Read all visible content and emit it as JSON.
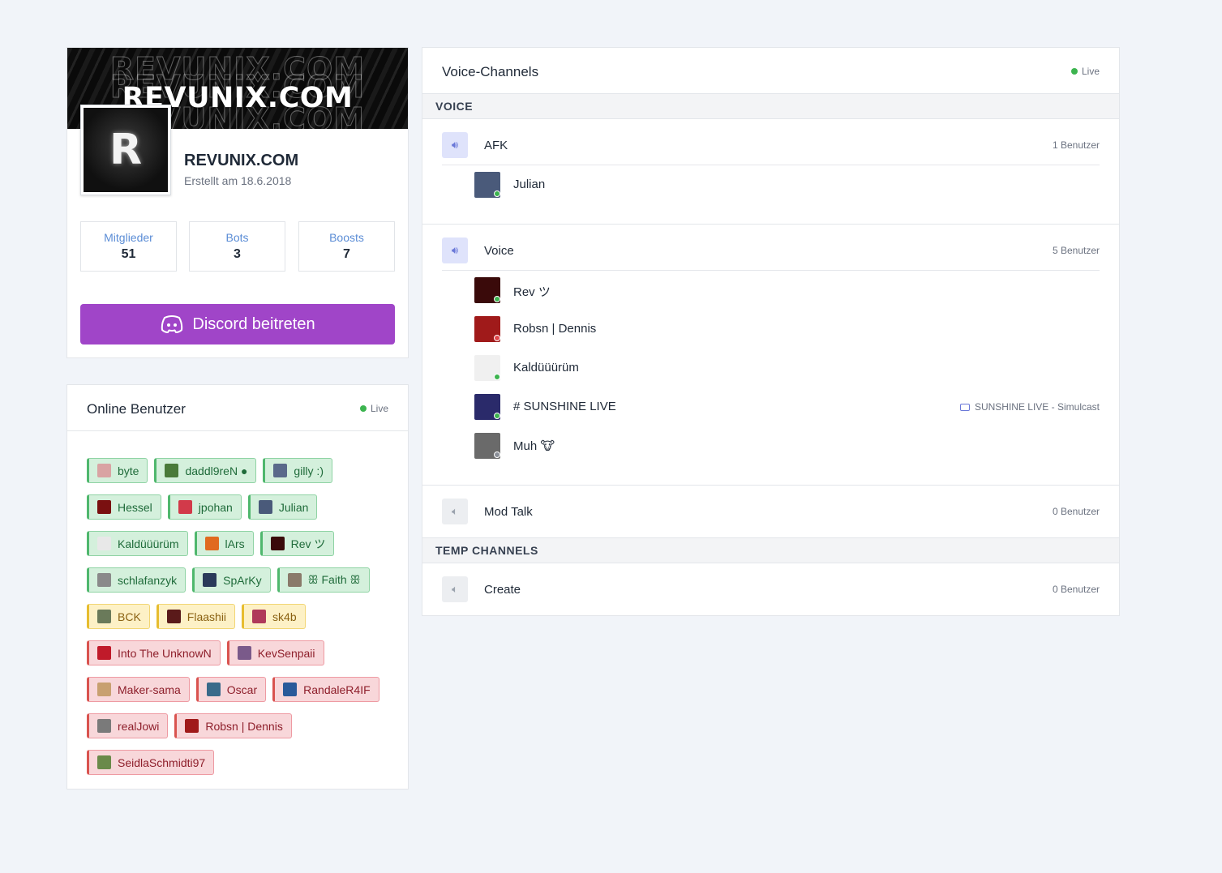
{
  "server": {
    "banner_text": "REVUNIX.COM",
    "icon_letter": "R",
    "name": "REVUNIX.COM",
    "created": "Erstellt am 18.6.2018",
    "stats": {
      "members_label": "Mitglieder",
      "members_value": "51",
      "bots_label": "Bots",
      "bots_value": "3",
      "boosts_label": "Boosts",
      "boosts_value": "7"
    },
    "join_label": "Discord beitreten",
    "join_color": "#a045c8"
  },
  "online": {
    "title": "Online Benutzer",
    "live_label": "Live",
    "users": [
      {
        "name": "byte",
        "status": "online",
        "avatar": "#d9a3a3"
      },
      {
        "name": "daddl9reN ●",
        "status": "online",
        "avatar": "#4a7a3a"
      },
      {
        "name": "gilly :)",
        "status": "online",
        "avatar": "#5a6a8a"
      },
      {
        "name": "Hessel",
        "status": "online",
        "avatar": "#7a1010"
      },
      {
        "name": "jpohan",
        "status": "online",
        "avatar": "#d23a4a"
      },
      {
        "name": "Julian",
        "status": "online",
        "avatar": "#4a5a7a"
      },
      {
        "name": "Kaldüüürüm",
        "status": "online",
        "avatar": "#e8e8e8"
      },
      {
        "name": "lArs",
        "status": "online",
        "avatar": "#e06a20"
      },
      {
        "name": "Rev ツ",
        "status": "online",
        "avatar": "#3a0a0a"
      },
      {
        "name": "schlafanzyk",
        "status": "online",
        "avatar": "#8a8a8a"
      },
      {
        "name": "SpArKy",
        "status": "online",
        "avatar": "#2a3a5a"
      },
      {
        "name": "ꕥ Faith ꕥ",
        "status": "online",
        "avatar": "#8a7a6a"
      },
      {
        "name": "BCK",
        "status": "idle",
        "avatar": "#6a7a5a"
      },
      {
        "name": "Flaashii",
        "status": "idle",
        "avatar": "#5a1a1a"
      },
      {
        "name": "sk4b",
        "status": "idle",
        "avatar": "#b03a5a"
      },
      {
        "name": "Into The UnknowN",
        "status": "dnd",
        "avatar": "#c01a2a"
      },
      {
        "name": "KevSenpaii",
        "status": "dnd",
        "avatar": "#7a5a8a"
      },
      {
        "name": "Maker-sama",
        "status": "dnd",
        "avatar": "#c8a070"
      },
      {
        "name": "Oscar",
        "status": "dnd",
        "avatar": "#3a6a8a"
      },
      {
        "name": "RandaleR4IF",
        "status": "dnd",
        "avatar": "#2a5a9a"
      },
      {
        "name": "realJowi",
        "status": "dnd",
        "avatar": "#7a7a7a"
      },
      {
        "name": "Robsn | Dennis",
        "status": "dnd",
        "avatar": "#a01a1a"
      },
      {
        "name": "SeidlaSchmidti97",
        "status": "dnd",
        "avatar": "#6a8a4a"
      }
    ]
  },
  "voice": {
    "title": "Voice-Channels",
    "live_label": "Live",
    "sections": [
      {
        "name": "VOICE"
      },
      {
        "name": "TEMP CHANNELS"
      }
    ],
    "channels": {
      "afk": {
        "name": "AFK",
        "count": "1 Benutzer",
        "icon": "speaker-icon"
      },
      "voice": {
        "name": "Voice",
        "count": "5 Benutzer",
        "icon": "speaker-icon"
      },
      "modtalk": {
        "name": "Mod Talk",
        "count": "0 Benutzer",
        "icon": "speaker-muted-icon"
      },
      "create": {
        "name": "Create",
        "count": "0 Benutzer",
        "icon": "speaker-muted-icon"
      }
    },
    "afk_members": [
      {
        "name": "Julian",
        "status": "online",
        "avatar": "#4a5a7a"
      }
    ],
    "voice_members": [
      {
        "name": "Rev ツ",
        "status": "online",
        "avatar": "#3a0a0a",
        "activity": ""
      },
      {
        "name": "Robsn | Dennis",
        "status": "dnd",
        "avatar": "#a01a1a",
        "activity": ""
      },
      {
        "name": "Kaldüüürüm",
        "status": "online",
        "avatar": "#f0f0f0",
        "activity": ""
      },
      {
        "name": "# SUNSHINE LIVE",
        "status": "online",
        "avatar": "#2a2a6a",
        "activity": "SUNSHINE LIVE - Simulcast"
      },
      {
        "name": "Muh 🐮",
        "status": "offline",
        "avatar": "#6a6a6a",
        "activity": ""
      }
    ]
  },
  "colors": {
    "background": "#f1f4f9",
    "online": "#3cb44f",
    "dnd": "#e0474c",
    "idle": "#e7bd2f",
    "accent_blue": "#5b8dd6"
  }
}
